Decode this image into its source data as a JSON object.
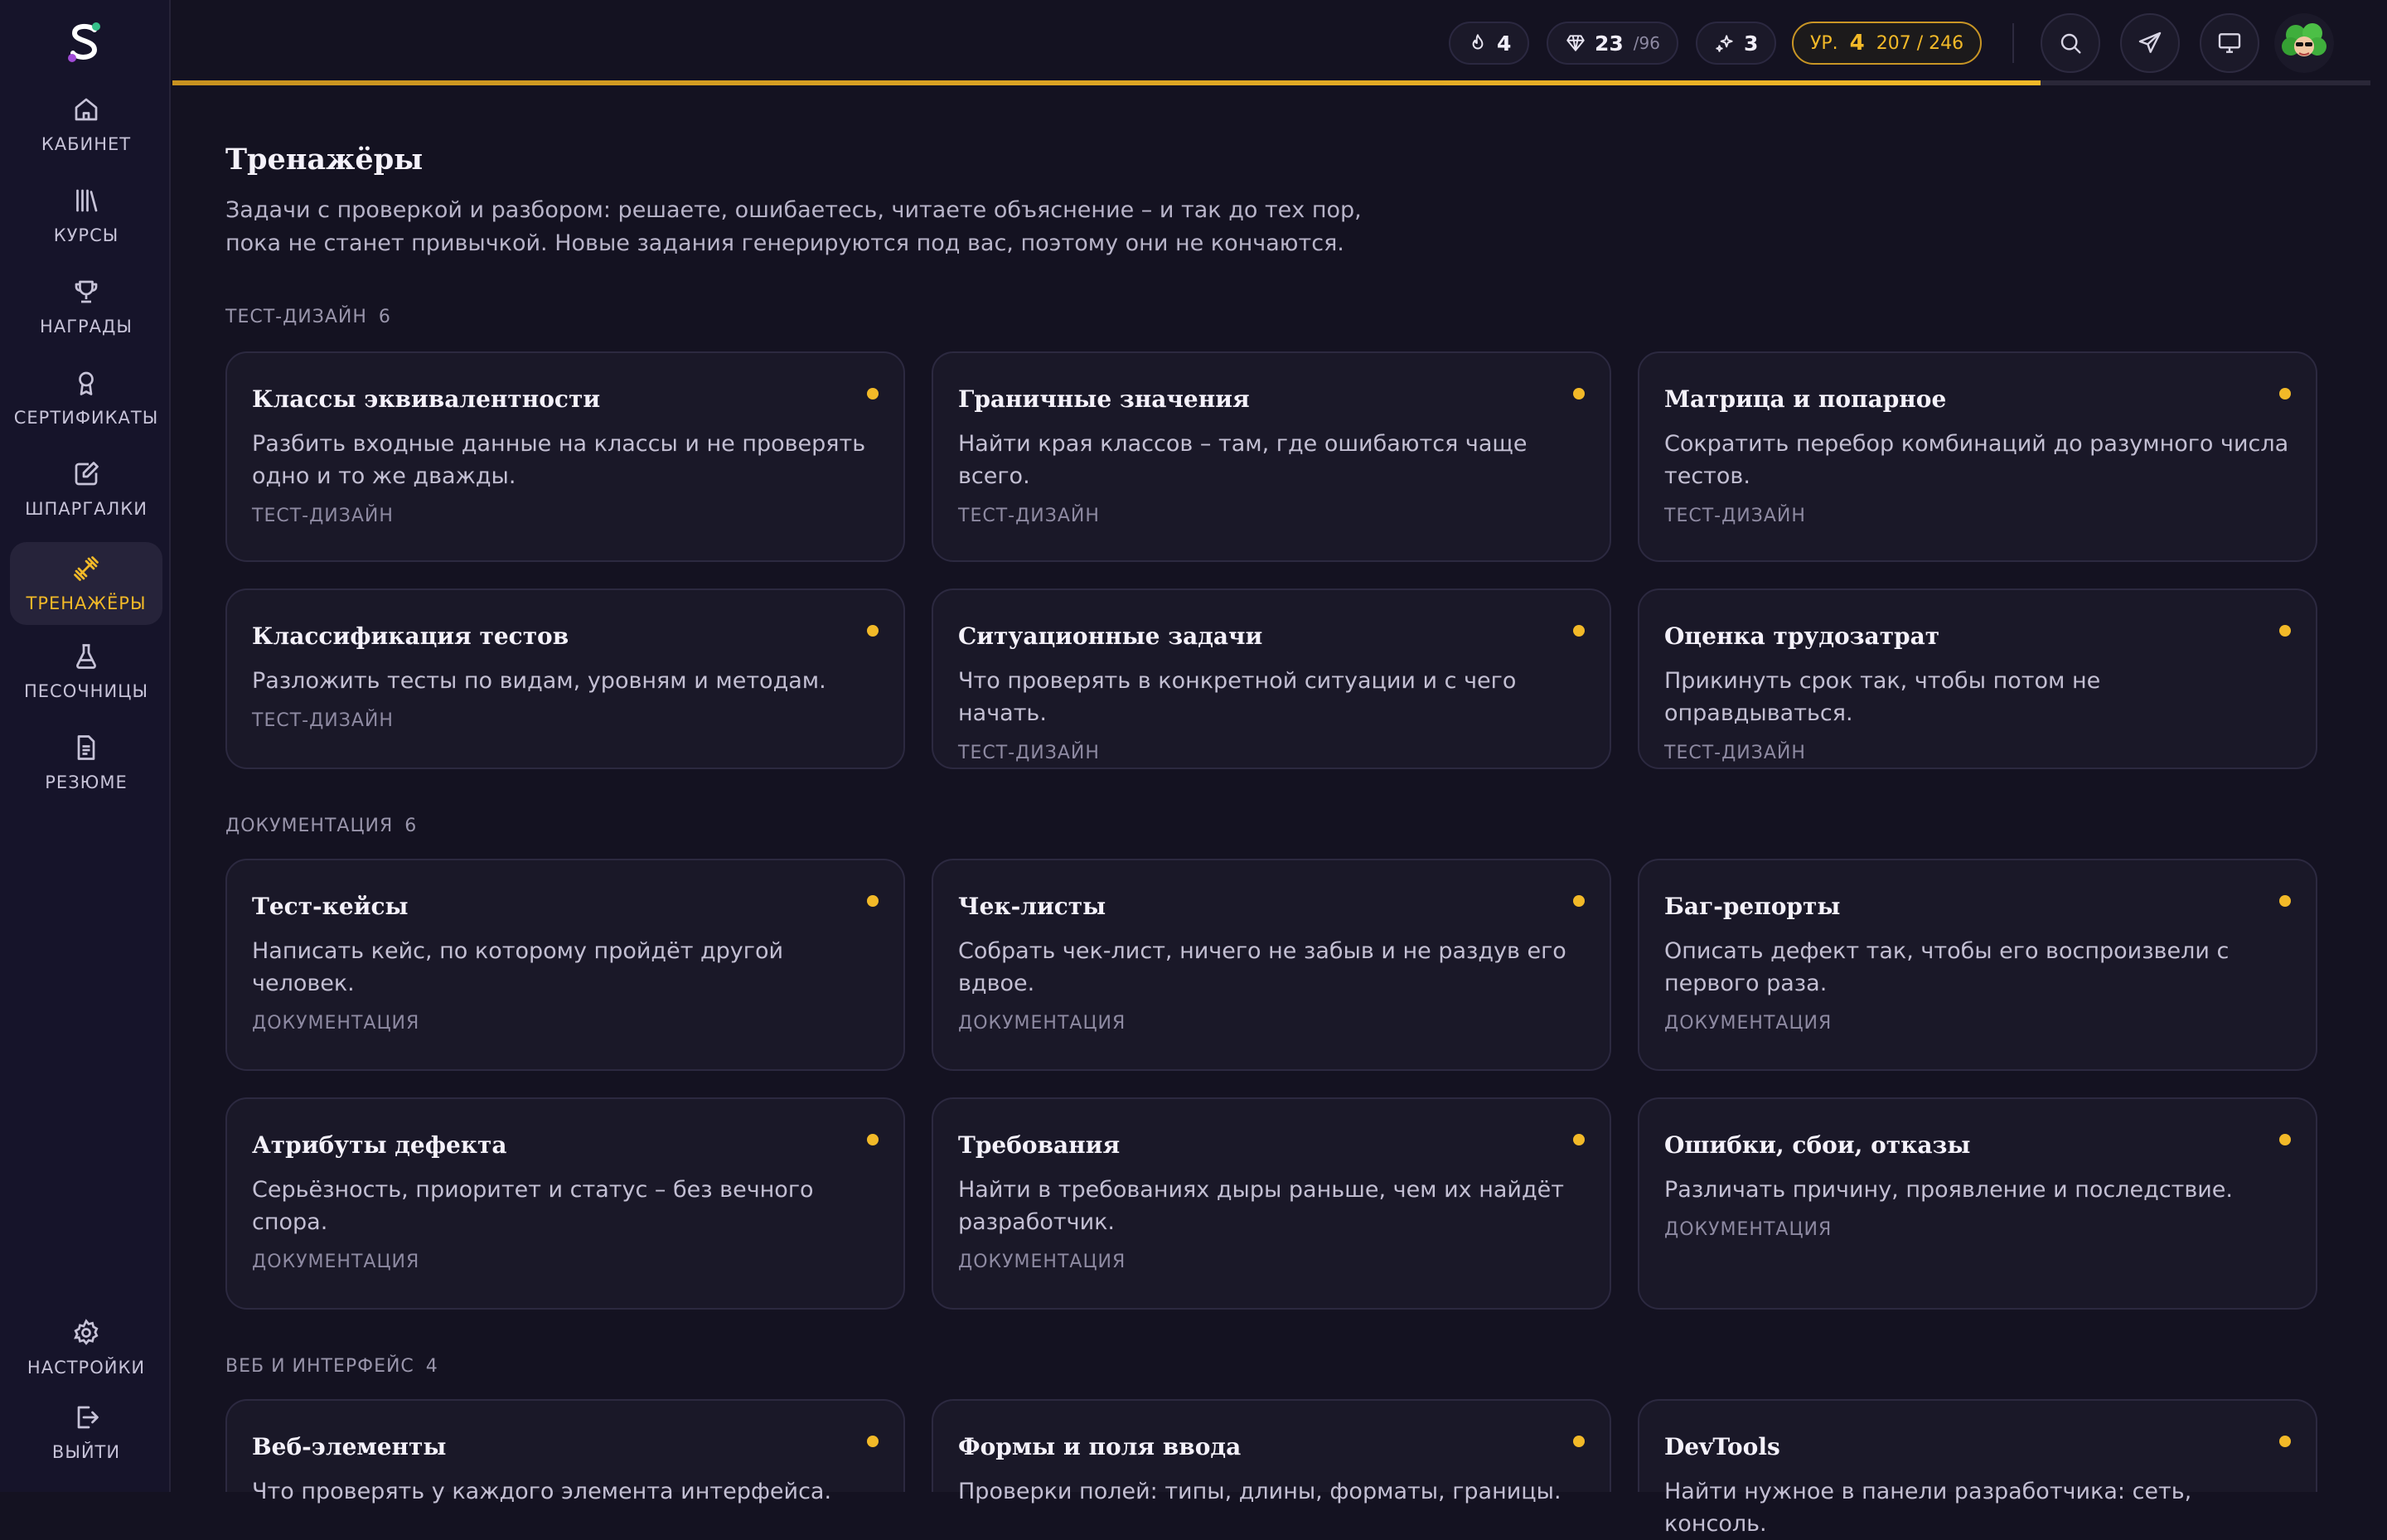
{
  "nav": {
    "items": [
      {
        "label": "КАБИНЕТ",
        "icon": "home-icon"
      },
      {
        "label": "КУРСЫ",
        "icon": "books-icon"
      },
      {
        "label": "НАГРАДЫ",
        "icon": "trophy-icon"
      },
      {
        "label": "СЕРТИФИКАТЫ",
        "icon": "award-icon"
      },
      {
        "label": "ШПАРГАЛКИ",
        "icon": "edit-note-icon"
      },
      {
        "label": "ТРЕНАЖЁРЫ",
        "icon": "dumbbell-icon"
      },
      {
        "label": "ПЕСОЧНИЦЫ",
        "icon": "flask-icon"
      },
      {
        "label": "РЕЗЮМЕ",
        "icon": "document-icon"
      }
    ],
    "active": "ТРЕНАЖЁРЫ",
    "settings_label": "НАСТРОЙКИ",
    "logout_label": "ВЫЙТИ"
  },
  "topbar": {
    "streak": "4",
    "gems": "23",
    "gems_total": "/96",
    "sparks": "3",
    "level_prefix": "УР.",
    "level": "4",
    "xp": "207 / 246",
    "xp_current": 207,
    "xp_max": 246,
    "page_progress": 0.85
  },
  "page": {
    "title": "Тренажёры",
    "description": "Задачи с проверкой и разбором: решаете, ошибаетесь, читаете объяснение – и так до тех пор, пока не станет привычкой. Новые задания генерируются под вас, поэтому они не кончаются."
  },
  "sections": [
    {
      "title": "ТЕСТ-ДИЗАЙН",
      "count": "6",
      "cards": [
        {
          "title": "Классы эквивалентности",
          "desc": "Разбить входные данные на классы и не проверять одно и то же дважды.",
          "tag": "ТЕСТ-ДИЗАЙН"
        },
        {
          "title": "Граничные значения",
          "desc": "Найти края классов – там, где ошибаются чаще всего.",
          "tag": "ТЕСТ-ДИЗАЙН"
        },
        {
          "title": "Матрица и попарное",
          "desc": "Сократить перебор комбинаций до разумного числа тестов.",
          "tag": "ТЕСТ-ДИЗАЙН"
        },
        {
          "title": "Классификация тестов",
          "desc": "Разложить тесты по видам, уровням и методам.",
          "tag": "ТЕСТ-ДИЗАЙН"
        },
        {
          "title": "Ситуационные задачи",
          "desc": "Что проверять в конкретной ситуации и с чего начать.",
          "tag": "ТЕСТ-ДИЗАЙН"
        },
        {
          "title": "Оценка трудозатрат",
          "desc": "Прикинуть срок так, чтобы потом не оправдываться.",
          "tag": "ТЕСТ-ДИЗАЙН"
        }
      ]
    },
    {
      "title": "ДОКУМЕНТАЦИЯ",
      "count": "6",
      "cards": [
        {
          "title": "Тест-кейсы",
          "desc": "Написать кейс, по которому пройдёт другой человек.",
          "tag": "ДОКУМЕНТАЦИЯ"
        },
        {
          "title": "Чек-листы",
          "desc": "Собрать чек-лист, ничего не забыв и не раздув его вдвое.",
          "tag": "ДОКУМЕНТАЦИЯ"
        },
        {
          "title": "Баг-репорты",
          "desc": "Описать дефект так, чтобы его воспроизвели с первого раза.",
          "tag": "ДОКУМЕНТАЦИЯ"
        },
        {
          "title": "Атрибуты дефекта",
          "desc": "Серьёзность, приоритет и статус – без вечного спора.",
          "tag": "ДОКУМЕНТАЦИЯ"
        },
        {
          "title": "Требования",
          "desc": "Найти в требованиях дыры раньше, чем их найдёт разработчик.",
          "tag": "ДОКУМЕНТАЦИЯ"
        },
        {
          "title": "Ошибки, сбои, отказы",
          "desc": "Различать причину, проявление и последствие.",
          "tag": "ДОКУМЕНТАЦИЯ"
        }
      ]
    },
    {
      "title": "ВЕБ И ИНТЕРФЕЙС",
      "count": "4",
      "cards": [
        {
          "title": "Веб-элементы",
          "desc": "Что проверять у каждого элемента интерфейса.",
          "tag": ""
        },
        {
          "title": "Формы и поля ввода",
          "desc": "Проверки полей: типы, длины, форматы, границы.",
          "tag": ""
        },
        {
          "title": "DevTools",
          "desc": "Найти нужное в панели разработчика: сеть, консоль.",
          "tag": ""
        }
      ]
    }
  ],
  "colors": {
    "accent": "#f2b928",
    "background": "#141221",
    "card": "#1a1828",
    "sidebar": "#16142a"
  }
}
